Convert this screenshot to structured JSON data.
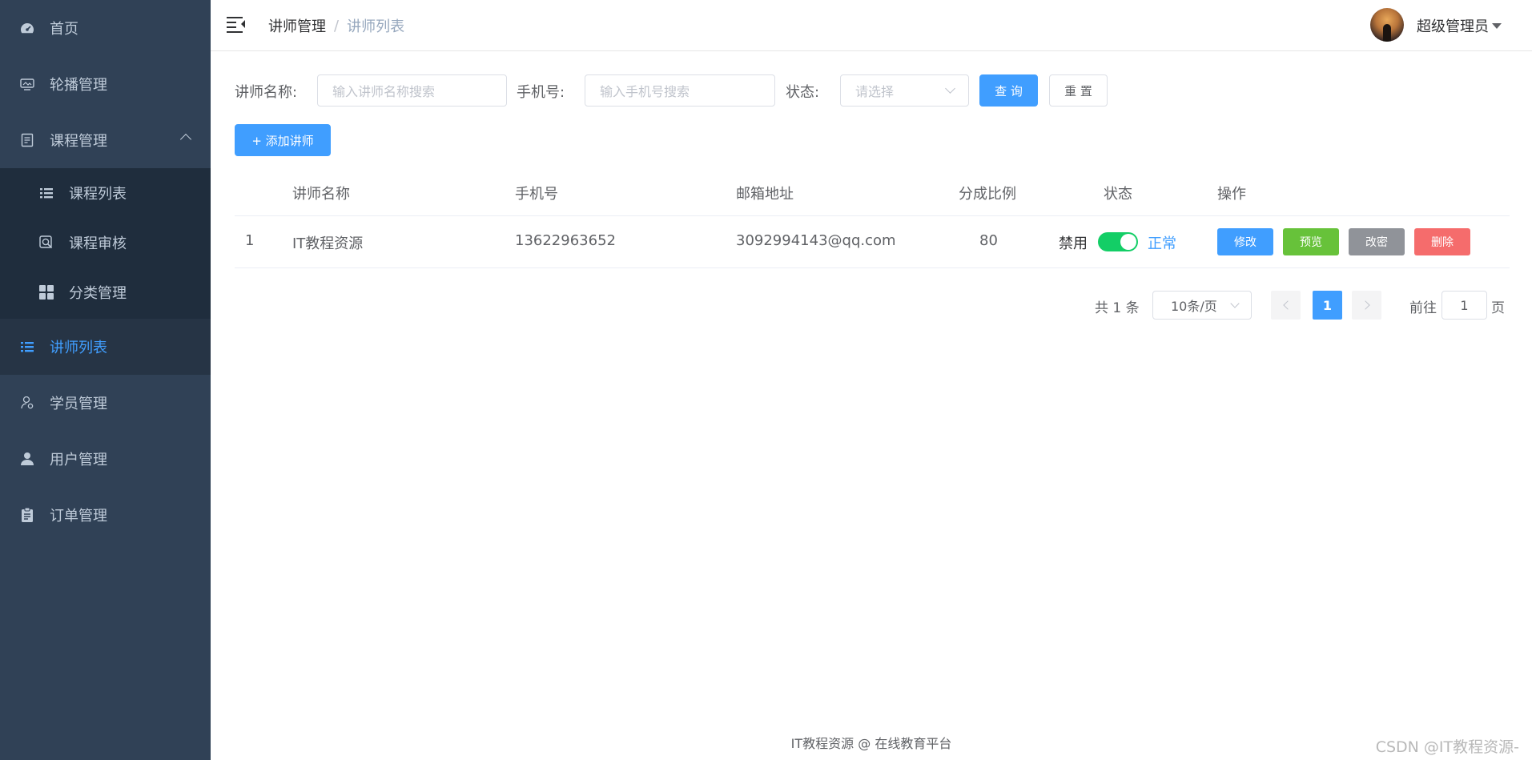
{
  "sidebar": {
    "items": [
      {
        "label": "首页",
        "icon": "dashboard-icon"
      },
      {
        "label": "轮播管理",
        "icon": "carousel-icon"
      },
      {
        "label": "课程管理",
        "icon": "course-icon"
      },
      {
        "label": "讲师列表",
        "icon": "list-icon"
      },
      {
        "label": "学员管理",
        "icon": "student-icon"
      },
      {
        "label": "用户管理",
        "icon": "user-icon"
      },
      {
        "label": "订单管理",
        "icon": "order-icon"
      }
    ],
    "submenu": [
      {
        "label": "课程列表",
        "icon": "list-icon"
      },
      {
        "label": "课程审核",
        "icon": "audit-icon"
      },
      {
        "label": "分类管理",
        "icon": "grid-icon"
      }
    ],
    "active_color": "#409eff",
    "bg_color": "#304156"
  },
  "header": {
    "breadcrumb": [
      "讲师管理",
      "讲师列表"
    ],
    "breadcrumb_sep": "/",
    "user_name": "超级管理员"
  },
  "search": {
    "name_label": "讲师名称:",
    "name_placeholder": "输入讲师名称搜索",
    "phone_label": "手机号:",
    "phone_placeholder": "输入手机号搜索",
    "status_label": "状态:",
    "status_placeholder": "请选择",
    "query_button": "查 询",
    "reset_button": "重 置"
  },
  "add_button": "+ 添加讲师",
  "table": {
    "columns": [
      "讲师名称",
      "手机号",
      "邮箱地址",
      "分成比例",
      "状态",
      "操作"
    ],
    "rows": [
      {
        "index": "1",
        "name": "IT教程资源",
        "phone": "13622963652",
        "email": "3092994143@qq.com",
        "ratio": "80",
        "status_off": "禁用",
        "status_on": "正常",
        "enabled": true,
        "actions": [
          "修改",
          "预览",
          "改密",
          "删除"
        ]
      }
    ]
  },
  "pagination": {
    "total": "共 1 条",
    "page_size": "10条/页",
    "current": "1",
    "goto_label": "前往",
    "goto_value": "1",
    "goto_suffix": "页"
  },
  "footer": "IT教程资源 @ 在线教育平台",
  "watermark": "CSDN @IT教程资源-"
}
